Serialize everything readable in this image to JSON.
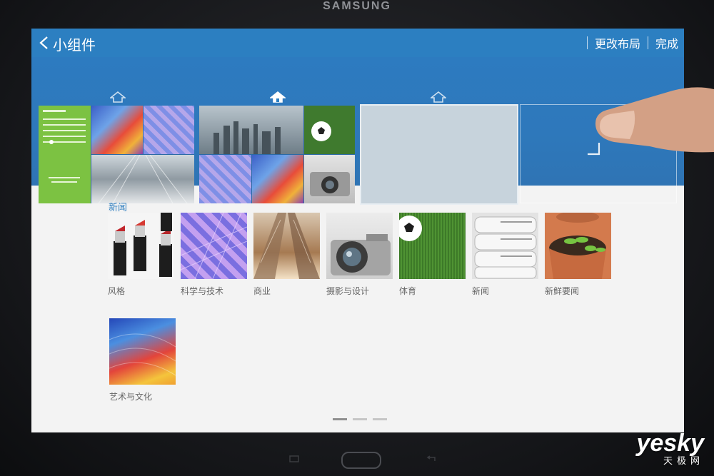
{
  "device": {
    "brand": "SAMSUNG"
  },
  "actionbar": {
    "title": "小组件",
    "actions": [
      "更改布局",
      "完成"
    ]
  },
  "section": {
    "title": "新闻"
  },
  "categories": [
    {
      "label": "风格",
      "image": "lipsticks"
    },
    {
      "label": "科学与技术",
      "image": "circuit-grid"
    },
    {
      "label": "商业",
      "image": "skyscrapers"
    },
    {
      "label": "摄影与设计",
      "image": "camera"
    },
    {
      "label": "体育",
      "image": "soccer-ball-on-grass"
    },
    {
      "label": "新闻",
      "image": "newspapers"
    },
    {
      "label": "新鲜要闻",
      "image": "seedlings-in-pots"
    },
    {
      "label": "艺术与文化",
      "image": "colorful-paint-strokes"
    }
  ],
  "watermark": {
    "main": "yesky",
    "sub": "天极网"
  },
  "colors": {
    "accent": "#2c7fc1",
    "calendar": "#7cc242"
  }
}
